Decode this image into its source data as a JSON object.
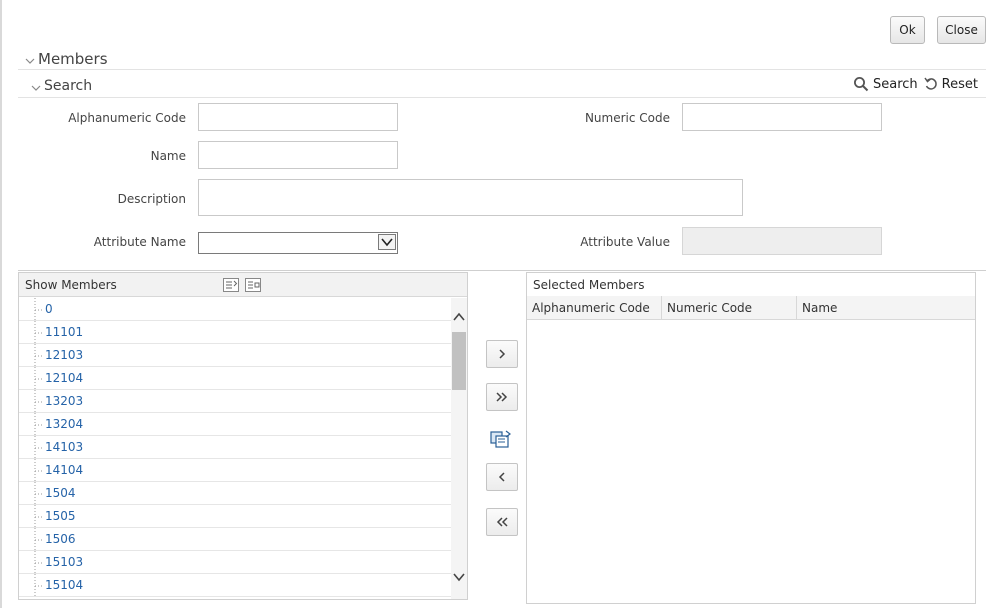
{
  "toolbar": {
    "ok_label": "Ok",
    "close_label": "Close"
  },
  "members_section": {
    "title": "Members"
  },
  "search_section": {
    "title": "Search",
    "search_label": "Search",
    "reset_label": "Reset"
  },
  "form": {
    "alphanumeric_code": {
      "label": "Alphanumeric Code",
      "value": ""
    },
    "numeric_code": {
      "label": "Numeric Code",
      "value": ""
    },
    "name": {
      "label": "Name",
      "value": ""
    },
    "description": {
      "label": "Description",
      "value": ""
    },
    "attribute_name": {
      "label": "Attribute Name",
      "value": ""
    },
    "attribute_value": {
      "label": "Attribute Value",
      "value": ""
    }
  },
  "show_members": {
    "title": "Show Members",
    "items": [
      "0",
      "11101",
      "12103",
      "12104",
      "13203",
      "13204",
      "14103",
      "14104",
      "1504",
      "1505",
      "1506",
      "15103",
      "15104"
    ]
  },
  "shuttle": {
    "move": "move-right-icon",
    "move_all": "move-all-right-icon",
    "copy": "copy-hierarchy-icon",
    "remove": "move-left-icon",
    "remove_all": "move-all-left-icon"
  },
  "selected_members": {
    "title": "Selected Members",
    "columns": [
      "Alphanumeric Code",
      "Numeric Code",
      "Name"
    ]
  },
  "colors": {
    "link": "#2563a8",
    "header_bg": "#f2f2f2",
    "border": "#d0d0d0"
  }
}
